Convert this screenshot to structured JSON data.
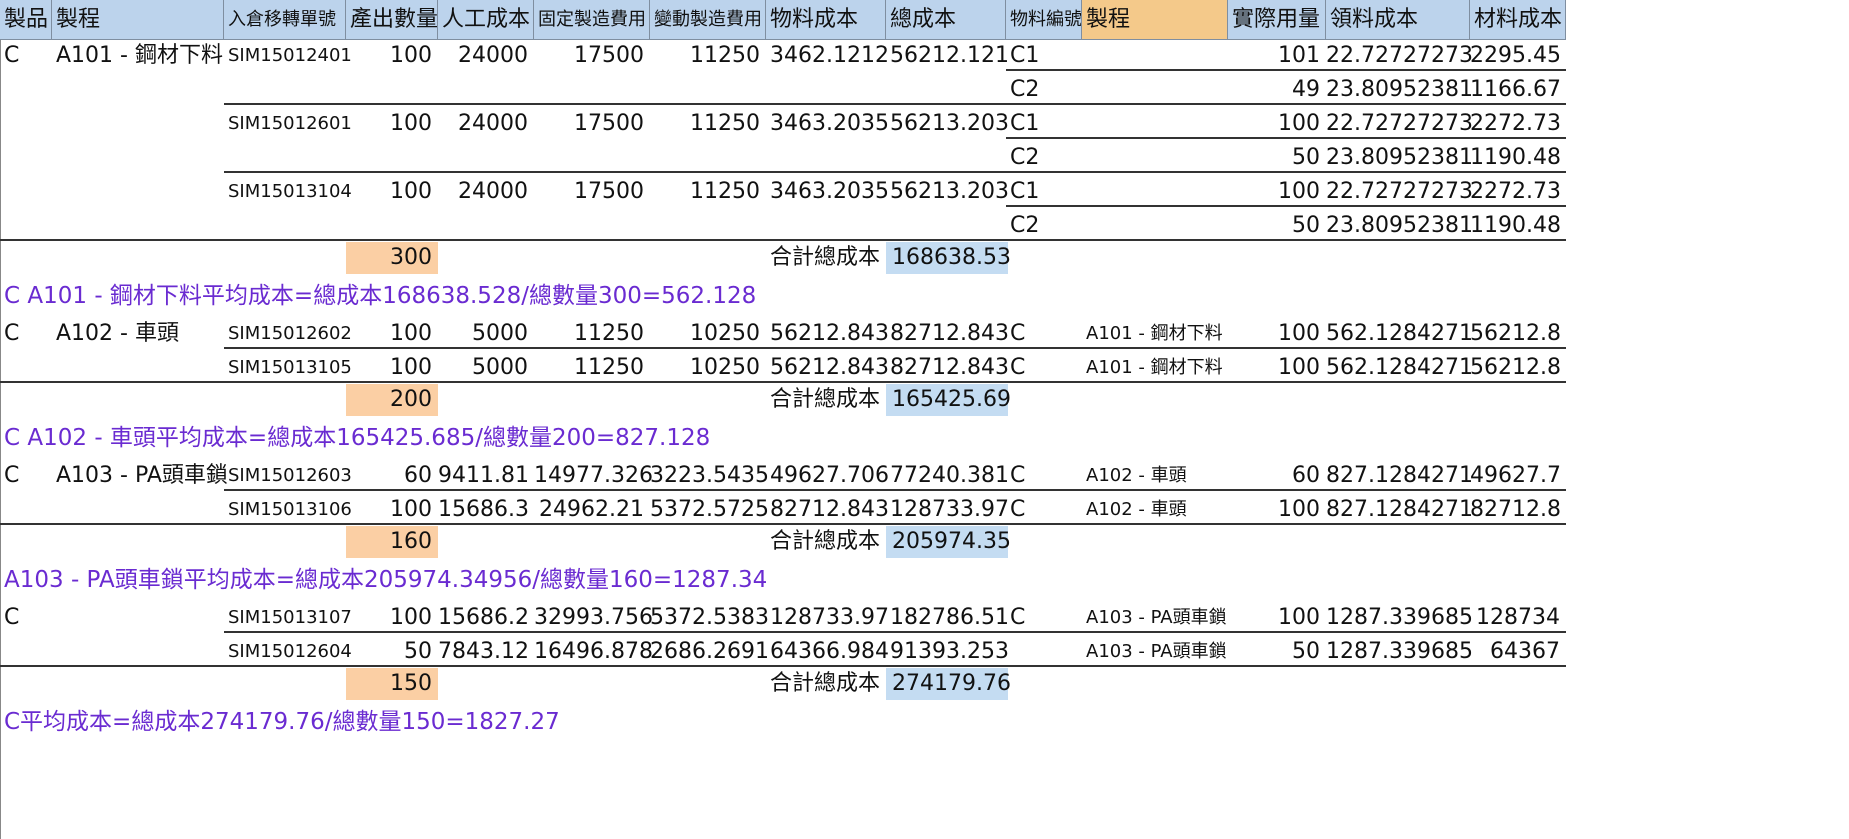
{
  "headers": [
    "製品",
    "製程",
    "入倉移轉單號",
    "產出數量",
    "人工成本",
    "固定製造費用",
    "變動製造費用",
    "物料成本",
    "總成本",
    "物料編號",
    "製程",
    "實際用量",
    "領料成本",
    "材料成本"
  ],
  "groups": [
    {
      "product": "C",
      "process": "A101 - 鋼材下料",
      "entries": [
        {
          "order": "SIM15012401",
          "qty": "100",
          "labor": "24000",
          "fixed": "17500",
          "variable": "11250",
          "material": "3462.1212",
          "total": "56212.121",
          "items": [
            {
              "code": "C1",
              "proc": "",
              "usage": "101",
              "unit_cost": "22.72727273",
              "mat_cost": "2295.45"
            },
            {
              "code": "C2",
              "proc": "",
              "usage": "49",
              "unit_cost": "23.80952381",
              "mat_cost": "1166.67"
            }
          ]
        },
        {
          "order": "SIM15012601",
          "qty": "100",
          "labor": "24000",
          "fixed": "17500",
          "variable": "11250",
          "material": "3463.2035",
          "total": "56213.203",
          "items": [
            {
              "code": "C1",
              "proc": "",
              "usage": "100",
              "unit_cost": "22.72727273",
              "mat_cost": "2272.73"
            },
            {
              "code": "C2",
              "proc": "",
              "usage": "50",
              "unit_cost": "23.80952381",
              "mat_cost": "1190.48"
            }
          ]
        },
        {
          "order": "SIM15013104",
          "qty": "100",
          "labor": "24000",
          "fixed": "17500",
          "variable": "11250",
          "material": "3463.2035",
          "total": "56213.203",
          "items": [
            {
              "code": "C1",
              "proc": "",
              "usage": "100",
              "unit_cost": "22.72727273",
              "mat_cost": "2272.73"
            },
            {
              "code": "C2",
              "proc": "",
              "usage": "50",
              "unit_cost": "23.80952381",
              "mat_cost": "1190.48"
            }
          ]
        }
      ],
      "qty_total": "300",
      "total_label": "合計總成本",
      "total_cost": "168638.53",
      "note": "C    A101 - 鋼材下料平均成本=總成本168638.528/總數量300=562.128"
    },
    {
      "product": "C",
      "process": "A102 - 車頭",
      "entries": [
        {
          "order": "SIM15012602",
          "qty": "100",
          "labor": "5000",
          "fixed": "11250",
          "variable": "10250",
          "material": "56212.843",
          "total": "82712.843",
          "items": [
            {
              "code": "C",
              "proc": "A101 - 鋼材下料",
              "usage": "100",
              "unit_cost": "562.1284271",
              "mat_cost": "56212.8"
            }
          ]
        },
        {
          "order": "SIM15013105",
          "qty": "100",
          "labor": "5000",
          "fixed": "11250",
          "variable": "10250",
          "material": "56212.843",
          "total": "82712.843",
          "items": [
            {
              "code": "C",
              "proc": "A101 - 鋼材下料",
              "usage": "100",
              "unit_cost": "562.1284271",
              "mat_cost": "56212.8"
            }
          ]
        }
      ],
      "qty_total": "200",
      "total_label": "合計總成本",
      "total_cost": "165425.69",
      "note": "C    A102 - 車頭平均成本=總成本165425.685/總數量200=827.128"
    },
    {
      "product": "C",
      "process": "A103 - PA頭車鎖",
      "entries": [
        {
          "order": "SIM15012603",
          "qty": "60",
          "labor": "9411.81",
          "fixed": "14977.326",
          "variable": "3223.5435",
          "material": "49627.706",
          "total": "77240.381",
          "items": [
            {
              "code": "C",
              "proc": "A102 - 車頭",
              "usage": "60",
              "unit_cost": "827.1284271",
              "mat_cost": "49627.7"
            }
          ]
        },
        {
          "order": "SIM15013106",
          "qty": "100",
          "labor": "15686.3",
          "fixed": "24962.21",
          "variable": "5372.5725",
          "material": "82712.843",
          "total": "128733.97",
          "items": [
            {
              "code": "C",
              "proc": "A102 - 車頭",
              "usage": "100",
              "unit_cost": "827.1284271",
              "mat_cost": "82712.8"
            }
          ]
        }
      ],
      "qty_total": "160",
      "total_label": "合計總成本",
      "total_cost": "205974.35",
      "note": " A103 - PA頭車鎖平均成本=總成本205974.34956/總數量160=1287.34"
    },
    {
      "product": "C",
      "process": "",
      "entries": [
        {
          "order": "SIM15013107",
          "qty": "100",
          "labor": "15686.2",
          "fixed": "32993.756",
          "variable": "5372.5383",
          "material": "128733.97",
          "total": "182786.51",
          "items": [
            {
              "code": "C",
              "proc": "A103 - PA頭車鎖",
              "usage": "100",
              "unit_cost": "1287.339685",
              "mat_cost": "128734"
            }
          ]
        },
        {
          "order": "SIM15012604",
          "qty": "50",
          "labor": "7843.12",
          "fixed": "16496.878",
          "variable": "2686.2691",
          "material": "64366.984",
          "total": "91393.253",
          "items": [
            {
              "code": "",
              "proc": "A103 - PA頭車鎖",
              "usage": "50",
              "unit_cost": "1287.339685",
              "mat_cost": "64367"
            }
          ]
        }
      ],
      "qty_total": "150",
      "total_label": "合計總成本",
      "total_cost": "274179.76",
      "note": "C平均成本=總成本274179.76/總數量150=1827.27"
    }
  ]
}
